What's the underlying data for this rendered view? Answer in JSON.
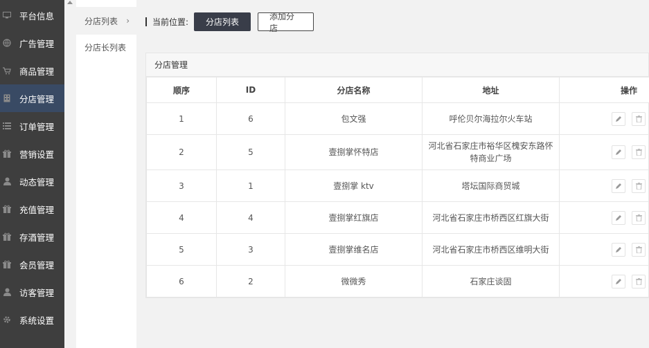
{
  "nav": {
    "items": [
      {
        "label": "平台信息",
        "icon": "monitor-icon"
      },
      {
        "label": "广告管理",
        "icon": "globe-icon"
      },
      {
        "label": "商品管理",
        "icon": "cart-icon"
      },
      {
        "label": "分店管理",
        "icon": "building-icon",
        "active": true
      },
      {
        "label": "订单管理",
        "icon": "list-icon"
      },
      {
        "label": "营销设置",
        "icon": "gift-icon"
      },
      {
        "label": "动态管理",
        "icon": "user-icon"
      },
      {
        "label": "充值管理",
        "icon": "gift-icon"
      },
      {
        "label": "存酒管理",
        "icon": "gift-icon"
      },
      {
        "label": "会员管理",
        "icon": "gift-icon"
      },
      {
        "label": "访客管理",
        "icon": "user-icon"
      },
      {
        "label": "系统设置",
        "icon": "gear-icon"
      }
    ]
  },
  "subnav": {
    "items": [
      {
        "label": "分店列表",
        "active": true
      },
      {
        "label": "分店长列表"
      }
    ]
  },
  "breadcrumb": {
    "label": "当前位置:",
    "current_button": "分店列表",
    "add_button": "添加分店"
  },
  "panel": {
    "title": "分店管理"
  },
  "table": {
    "headers": [
      "顺序",
      "ID",
      "分店名称",
      "地址",
      "操作"
    ],
    "rows": [
      {
        "order": "1",
        "id": "6",
        "name": "包文强",
        "address": "呼伦贝尔海拉尔火车站"
      },
      {
        "order": "2",
        "id": "5",
        "name": "壹捌掌怀特店",
        "address": "河北省石家庄市裕华区槐安东路怀特商业广场"
      },
      {
        "order": "3",
        "id": "1",
        "name": "壹捌掌 ktv",
        "address": "塔坛国际商贸城"
      },
      {
        "order": "4",
        "id": "4",
        "name": "壹捌掌红旗店",
        "address": "河北省石家庄市桥西区红旗大街"
      },
      {
        "order": "5",
        "id": "3",
        "name": "壹捌掌维名店",
        "address": "河北省石家庄市桥西区维明大街"
      },
      {
        "order": "6",
        "id": "2",
        "name": "微微秀",
        "address": "石家庄谈固"
      }
    ]
  },
  "colors": {
    "nav_bg": "#3e3e3e",
    "nav_active": "#394a64",
    "primary_button": "#393d49"
  }
}
